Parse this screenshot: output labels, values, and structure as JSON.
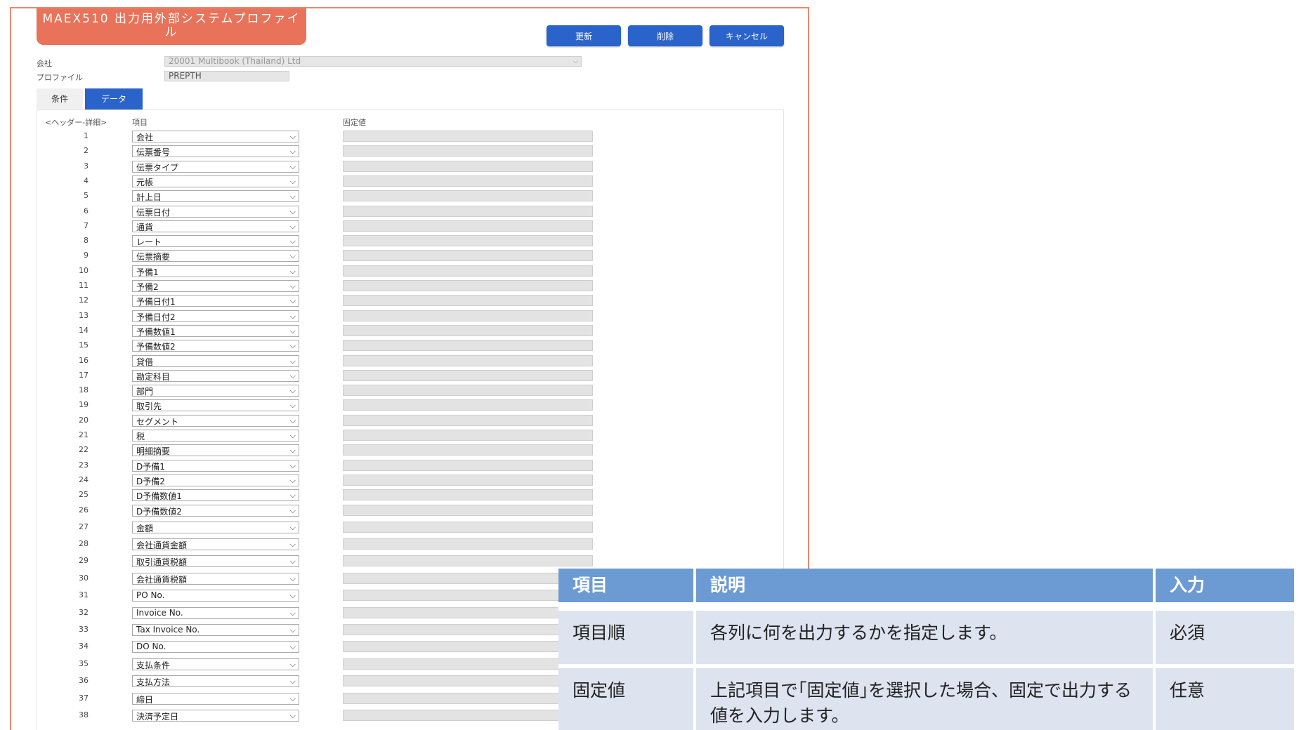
{
  "app": {
    "title": "MAEX510 出力用外部システムプロファイル",
    "buttons": {
      "update": "更新",
      "delete": "削除",
      "cancel": "キャンセル"
    },
    "company_label": "会社",
    "company_value": "20001 Multibook (Thailand) Ltd",
    "profile_label": "プロファイル",
    "profile_value": "PREPTH",
    "tabs": [
      {
        "label": "条件"
      },
      {
        "label": "データ",
        "active": true
      }
    ],
    "grid_headers": {
      "section": "<ヘッダー-詳細>",
      "item": "項目",
      "fixed": "固定値"
    },
    "rows": [
      {
        "n": "1",
        "item": "会社"
      },
      {
        "n": "2",
        "item": "伝票番号"
      },
      {
        "n": "3",
        "item": "伝票タイプ"
      },
      {
        "n": "4",
        "item": "元帳"
      },
      {
        "n": "5",
        "item": "計上日"
      },
      {
        "n": "6",
        "item": "伝票日付"
      },
      {
        "n": "7",
        "item": "通貨"
      },
      {
        "n": "8",
        "item": "レート"
      },
      {
        "n": "9",
        "item": "伝票摘要"
      },
      {
        "n": "10",
        "item": "予備1"
      },
      {
        "n": "11",
        "item": "予備2"
      },
      {
        "n": "12",
        "item": "予備日付1"
      },
      {
        "n": "13",
        "item": "予備日付2"
      },
      {
        "n": "14",
        "item": "予備数値1"
      },
      {
        "n": "15",
        "item": "予備数値2"
      },
      {
        "n": "16",
        "item": "貸借"
      },
      {
        "n": "17",
        "item": "勘定科目"
      },
      {
        "n": "18",
        "item": "部門"
      },
      {
        "n": "19",
        "item": "取引先"
      },
      {
        "n": "20",
        "item": "セグメント"
      },
      {
        "n": "21",
        "item": "税"
      },
      {
        "n": "22",
        "item": "明細摘要"
      },
      {
        "n": "23",
        "item": "D予備1"
      },
      {
        "n": "24",
        "item": "D予備2"
      },
      {
        "n": "25",
        "item": "D予備数値1"
      },
      {
        "n": "26",
        "item": "D予備数値2"
      },
      {
        "n": "27",
        "item": "金額"
      },
      {
        "n": "28",
        "item": "会社通貨金額"
      },
      {
        "n": "29",
        "item": "取引通貨税額"
      },
      {
        "n": "30",
        "item": "会社通貨税額"
      },
      {
        "n": "31",
        "item": "PO No."
      },
      {
        "n": "32",
        "item": "Invoice No."
      },
      {
        "n": "33",
        "item": "Tax Invoice No."
      },
      {
        "n": "34",
        "item": "DO No."
      },
      {
        "n": "35",
        "item": "支払条件"
      },
      {
        "n": "36",
        "item": "支払方法"
      },
      {
        "n": "37",
        "item": "締日"
      },
      {
        "n": "38",
        "item": "決済予定日"
      }
    ]
  },
  "legend": {
    "headers": {
      "item": "項目",
      "desc": "説明",
      "input": "入力"
    },
    "rows": [
      {
        "item": "項目順",
        "desc": "各列に何を出力するかを指定します。",
        "input": "必須"
      },
      {
        "item": "固定値",
        "desc": "上記項目で｢固定値｣を選択した場合、固定で出力する値を入力します。",
        "input": "任意"
      }
    ]
  }
}
